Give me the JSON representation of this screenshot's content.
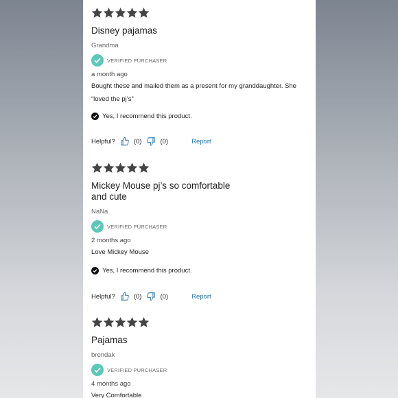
{
  "reviews": [
    {
      "stars": 5,
      "title": "Disney pajamas",
      "author": "Grandma",
      "verified_label": "VERIFIED PURCHASER",
      "date": "a month ago",
      "body": "Bought these and mailed them as a present for my granddaughter. She “loved the pj’s”",
      "recommend_text": "Yes,  I recommend this product.",
      "helpful_label": "Helpful?",
      "up_count": "(0)",
      "down_count": "(0)",
      "report_label": "Report"
    },
    {
      "stars": 5,
      "title": "Mickey Mouse pj’s so comfortable and cute",
      "author": "NaNa",
      "verified_label": "VERIFIED PURCHASER",
      "date": "2 months ago",
      "body": "Love Mickey Mouse",
      "recommend_text": "Yes,  I recommend this product.",
      "helpful_label": "Helpful?",
      "up_count": "(0)",
      "down_count": "(0)",
      "report_label": "Report"
    },
    {
      "stars": 5,
      "title": "Pajamas",
      "author": "brendak",
      "verified_label": "VERIFIED PURCHASER",
      "date": "4 months ago",
      "body": "Very Comfortable"
    }
  ],
  "colors": {
    "star": "#444444",
    "verified_check": "#5cc7b9",
    "report_link": "#1f6fa8"
  },
  "icons": {
    "star": "star-icon",
    "verified": "check-circle-icon",
    "recommend": "check-circle-filled-icon",
    "thumbs_up": "thumbs-up-icon",
    "thumbs_down": "thumbs-down-icon"
  }
}
